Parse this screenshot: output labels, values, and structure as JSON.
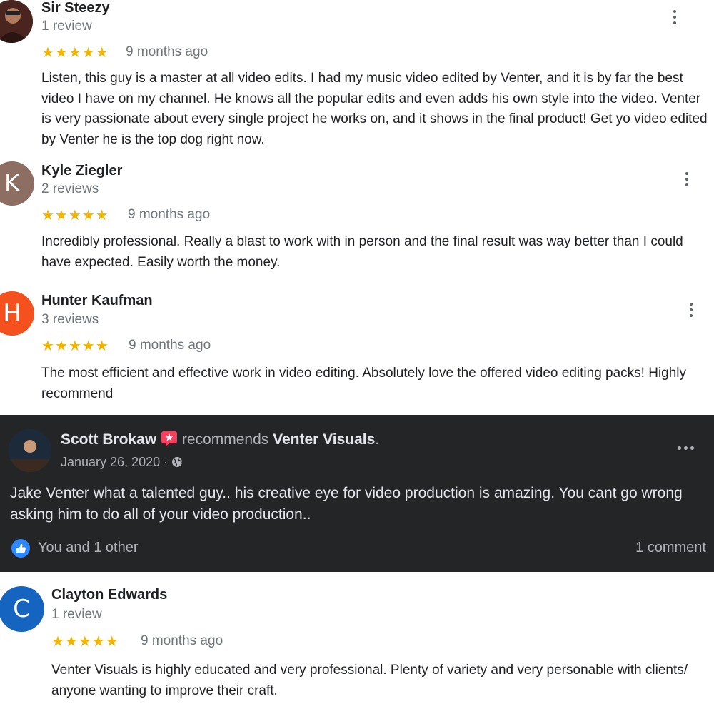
{
  "reviews": [
    {
      "name": "Sir Steezy",
      "count": "1 review",
      "stars": "★★★★★",
      "time": "9 months ago",
      "text": "Listen, this guy is a master at all video edits. I had my music video edited by Venter, and it is by far the best video I have on my channel. He knows all the popular edits and even adds his own style into the video. Venter is very passionate about every single project he works on, and it shows in the final product! Get yo video edited by Venter he is the top dog right now.",
      "avatar_type": "photo"
    },
    {
      "name": "Kyle Ziegler",
      "count": "2 reviews",
      "stars": "★★★★★",
      "time": "9 months ago",
      "text": "Incredibly professional. Really a blast to work with in person and the final result was way better than I could have expected. Easily worth the money.",
      "initial": "K",
      "avatar_color": "#8d6e63"
    },
    {
      "name": "Hunter Kaufman",
      "count": "3 reviews",
      "stars": "★★★★★",
      "time": "9 months ago",
      "text": "The most efficient and effective work in video editing. Absolutely love the offered video editing packs! Highly recommend",
      "initial": "H",
      "avatar_color": "#f4511e"
    },
    {
      "name": "Clayton Edwards",
      "count": "1 review",
      "stars": "★★★★★",
      "time": "9 months ago",
      "text": "Venter Visuals is highly educated and very professional. Plenty of variety and very personable with clients/ anyone wanting to improve their craft.",
      "initial": "C",
      "avatar_color": "#1565c0"
    }
  ],
  "facebook": {
    "name": "Scott Brokaw",
    "recommends": "recommends",
    "page": "Venter Visuals",
    "page_suffix": ".",
    "date": "January 26, 2020 ·",
    "text": "Jake Venter what a talented guy.. his creative eye for video production is amazing.  You cant go wrong asking him to do all of your video production..",
    "likes": "You and 1 other",
    "comments": "1 comment",
    "background": "#242526"
  },
  "colors": {
    "star": "#f5b400",
    "like_blue": "#2d88ff"
  }
}
